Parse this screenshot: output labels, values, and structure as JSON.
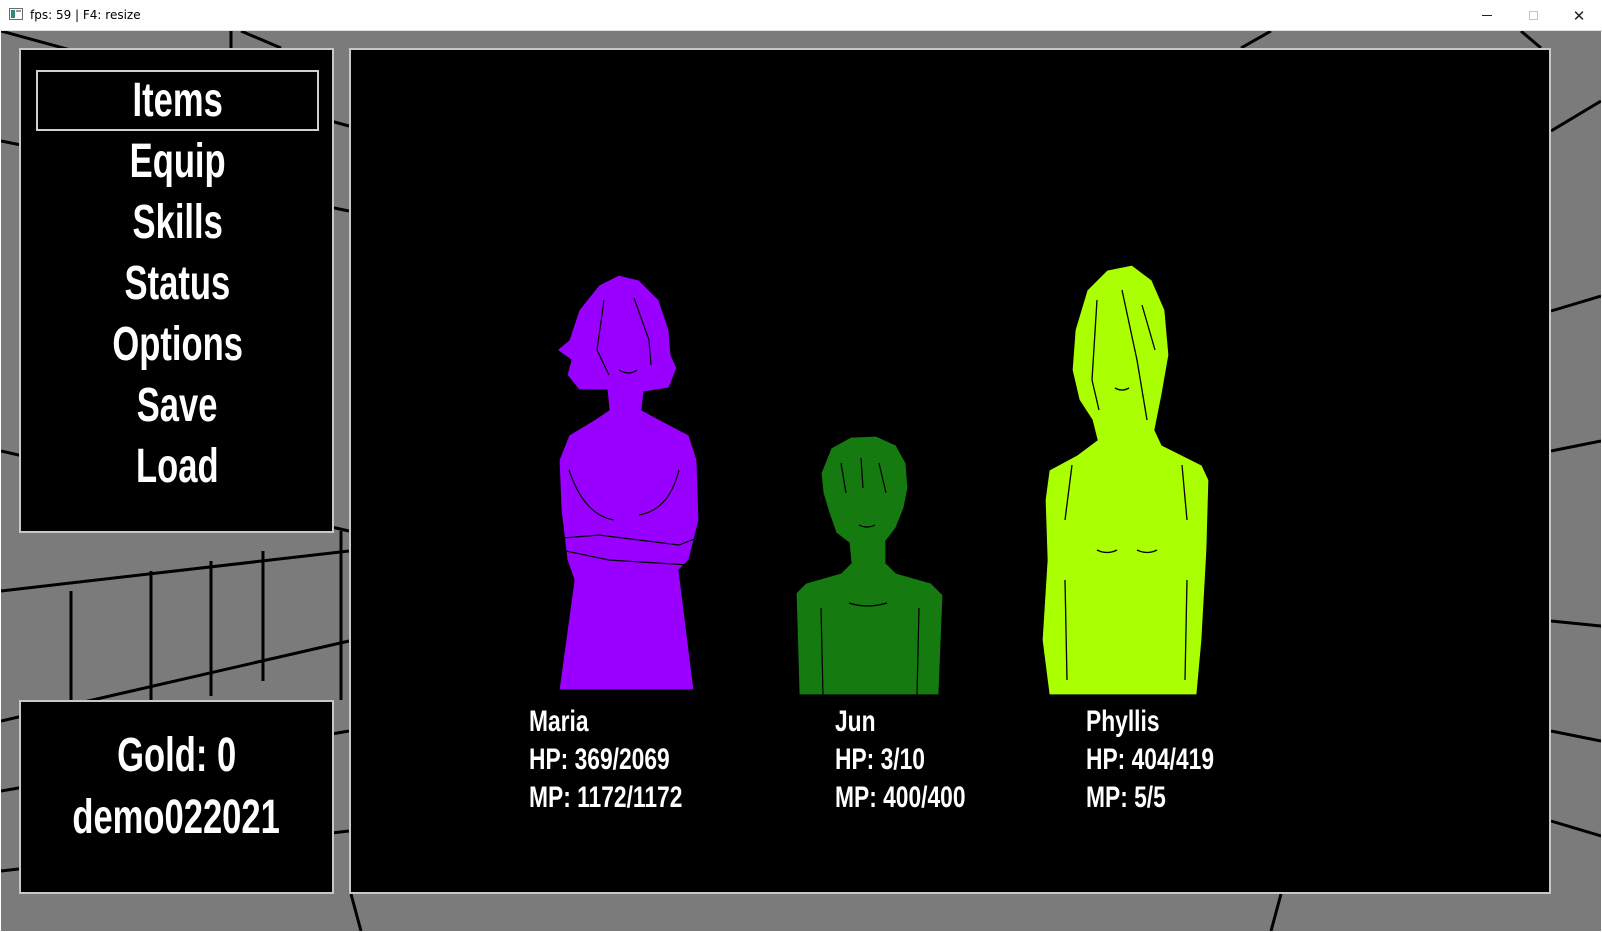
{
  "window": {
    "title": "fps: 59 | F4: resize",
    "minimize": "",
    "maximize": "",
    "close": "✕"
  },
  "menu": {
    "items": [
      {
        "label": "Items",
        "selected": true
      },
      {
        "label": "Equip",
        "selected": false
      },
      {
        "label": "Skills",
        "selected": false
      },
      {
        "label": "Status",
        "selected": false
      },
      {
        "label": "Options",
        "selected": false
      },
      {
        "label": "Save",
        "selected": false
      },
      {
        "label": "Load",
        "selected": false
      }
    ]
  },
  "info": {
    "gold": "Gold: 0",
    "save_name": "demo022021"
  },
  "party": [
    {
      "name": "Maria",
      "hp": "HP: 369/2069",
      "mp": "MP: 1172/1172",
      "color": "#9a00ff"
    },
    {
      "name": "Jun",
      "hp": "HP: 3/10",
      "mp": "MP: 400/400",
      "color": "#157a10"
    },
    {
      "name": "Phyllis",
      "hp": "HP: 404/419",
      "mp": "MP: 5/5",
      "color": "#aaff00"
    }
  ],
  "colors": {
    "panel_bg": "#000000",
    "panel_border": "#c8c8c8",
    "wall": "#7b7b7b",
    "text": "#ffffff"
  }
}
